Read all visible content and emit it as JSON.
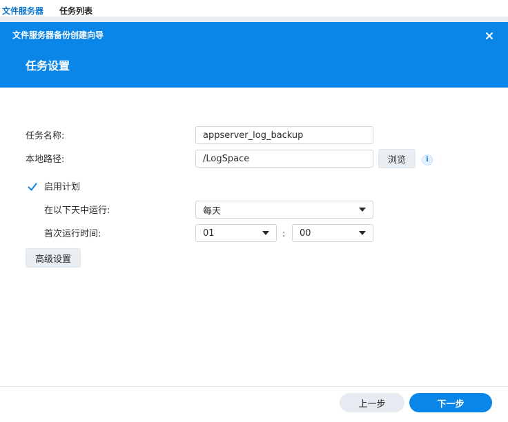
{
  "background_tabs": [
    {
      "label": "文件服务器",
      "active": true
    },
    {
      "label": "任务列表",
      "active": false
    }
  ],
  "dialog": {
    "window_title": "文件服务器备份创建向导",
    "step_title": "任务设置",
    "close_icon": "close-icon",
    "form": {
      "task_name_label": "任务名称:",
      "task_name_value": "appserver_log_backup",
      "local_path_label": "本地路径:",
      "local_path_value": "/LogSpace",
      "browse_button": "浏览",
      "info_icon": "info-icon",
      "enable_schedule_label": "启用计划",
      "enable_schedule_checked": true,
      "run_on_label": "在以下天中运行:",
      "run_on_value": "每天",
      "first_run_time_label": "首次运行时间:",
      "hour_value": "01",
      "time_separator": ":",
      "minute_value": "00",
      "advanced_button": "高级设置"
    },
    "footer": {
      "prev_button": "上一步",
      "next_button": "下一步"
    }
  },
  "colors": {
    "primary": "#0a86e8",
    "accent_text": "#0b74c8",
    "button_gray": "#e9eef2",
    "border": "#cfd6dc"
  }
}
